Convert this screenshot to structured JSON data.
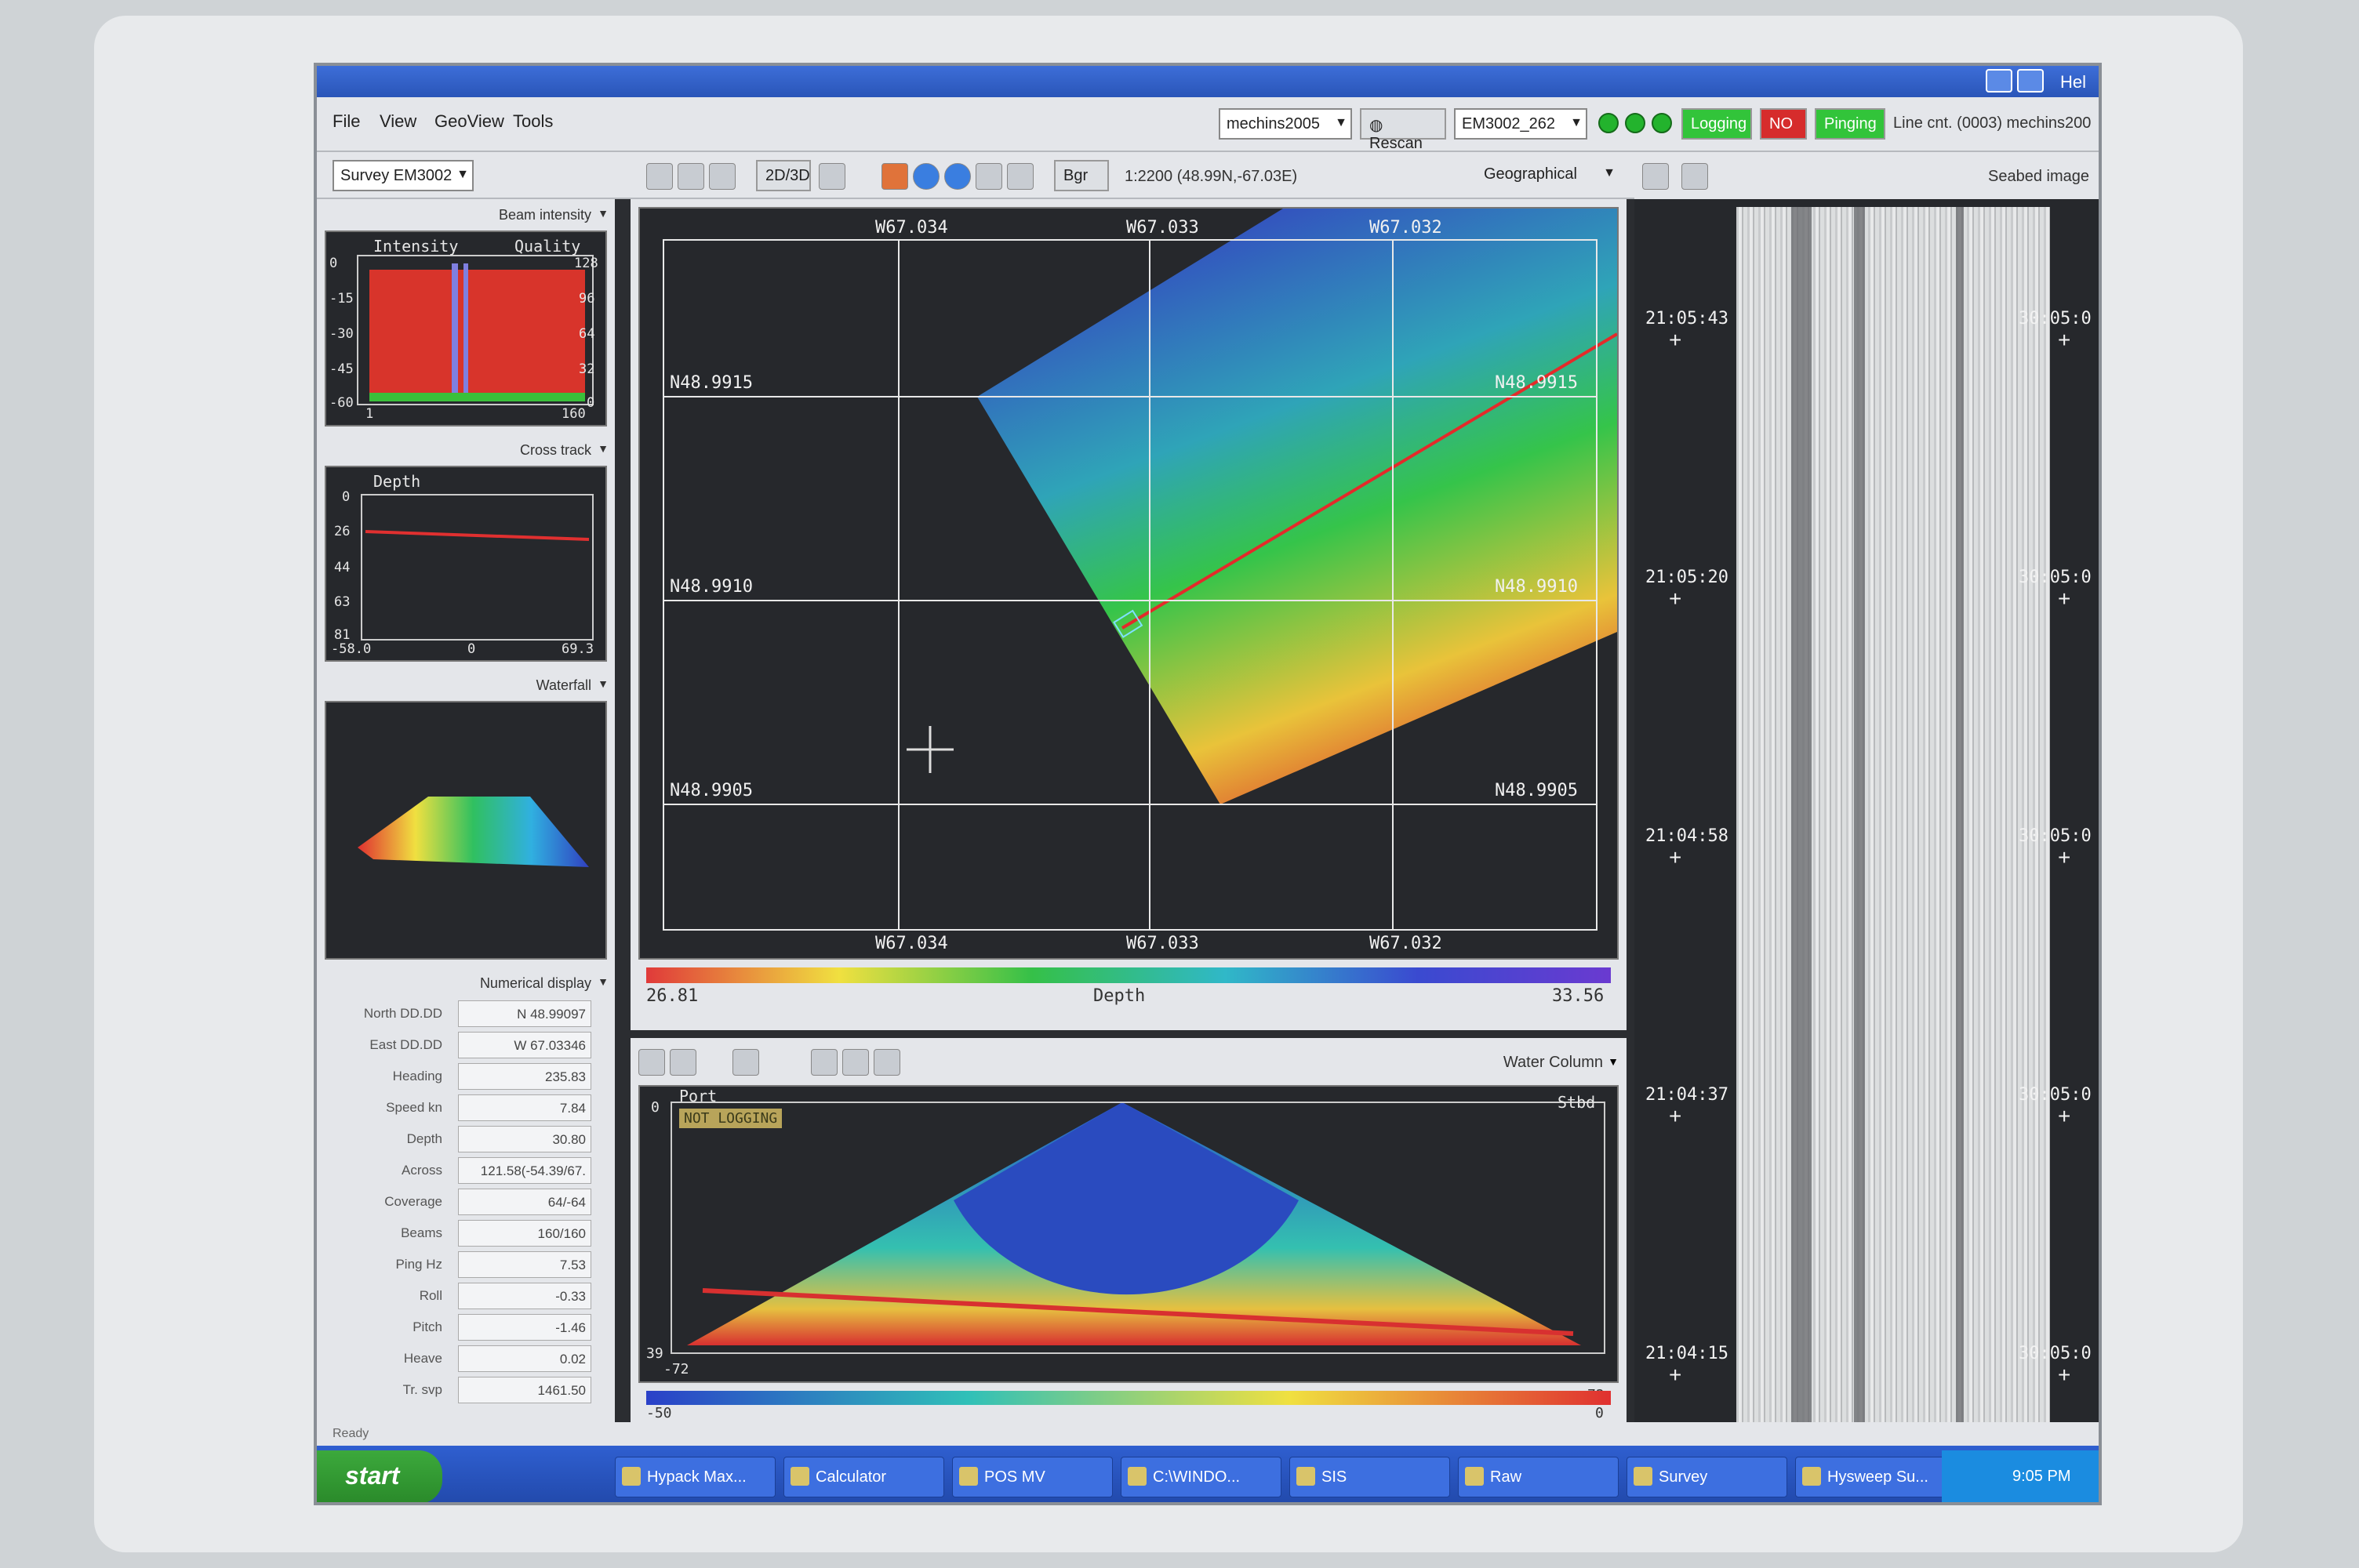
{
  "window": {
    "help_label": "Hel"
  },
  "menu": {
    "file": "File",
    "view": "View",
    "geoview": "GeoView",
    "tools": "Tools"
  },
  "header": {
    "project_combo": "mechins2005",
    "rescan_label": "Rescan",
    "sensor_combo": "EM3002_262",
    "logging": "Logging",
    "red_status": "NO",
    "pinging": "Pinging",
    "line_counter": "Line cnt. (0003) mechins200"
  },
  "toolbar": {
    "survey_combo": "Survey EM3002",
    "view_2d3d": "2D/3D",
    "bgr": "Bgr",
    "scale_readout": "1:2200 (48.99N,-67.03E)",
    "projection_combo": "Geographical",
    "seabed_label": "Seabed image"
  },
  "beam_panel": {
    "selector": "Beam intensity",
    "intensity_label": "Intensity",
    "quality_label": "Quality",
    "left_ticks": [
      "0",
      "-15",
      "-30",
      "-45",
      "-60"
    ],
    "right_ticks": [
      "128",
      "96",
      "64",
      "32",
      "0"
    ],
    "x_min": "1",
    "x_max": "160"
  },
  "cross_panel": {
    "selector": "Cross track",
    "depth_label": "Depth",
    "y_ticks": [
      "0",
      "26",
      "44",
      "63",
      "81"
    ],
    "x_ticks": [
      "-58.0",
      "0",
      "69.3"
    ]
  },
  "waterfall_panel": {
    "selector": "Waterfall"
  },
  "numerical": {
    "selector": "Numerical display",
    "rows": [
      {
        "label": "North DD.DD",
        "value": "N 48.99097"
      },
      {
        "label": "East DD.DD",
        "value": "W 67.03346"
      },
      {
        "label": "Heading",
        "value": "235.83"
      },
      {
        "label": "Speed kn",
        "value": "7.84"
      },
      {
        "label": "Depth",
        "value": "30.80"
      },
      {
        "label": "Across",
        "value": "121.58(-54.39/67."
      },
      {
        "label": "Coverage",
        "value": "64/-64"
      },
      {
        "label": "Beams",
        "value": "160/160"
      },
      {
        "label": "Ping Hz",
        "value": "7.53"
      },
      {
        "label": "Roll",
        "value": "-0.33"
      },
      {
        "label": "Pitch",
        "value": "-1.46"
      },
      {
        "label": "Heave",
        "value": "0.02"
      },
      {
        "label": "Tr. svp",
        "value": "1461.50"
      }
    ]
  },
  "map": {
    "top_lon": [
      "W67.034",
      "W67.033",
      "W67.032"
    ],
    "bottom_lon": [
      "W67.034",
      "W67.033",
      "W67.032"
    ],
    "left_lat": [
      "N48.9915",
      "N48.9910",
      "N48.9905"
    ],
    "right_lat": [
      "N48.9915",
      "N48.9910",
      "N48.9905"
    ],
    "colorbar_min": "26.81",
    "colorbar_label": "Depth",
    "colorbar_max": "33.56"
  },
  "water_column": {
    "selector": "Water Column",
    "port": "Port",
    "stbd": "Stbd",
    "not_logging": "NOT LOGGING",
    "y_top": "0",
    "y_bottom": "39",
    "x_min": "-72",
    "x_max": "72",
    "colorbar_min": "-50",
    "colorbar_max": "0"
  },
  "seabed": {
    "times": [
      "21:05:43",
      "21:05:20",
      "21:04:58",
      "21:04:37",
      "21:04:15"
    ],
    "right_times": [
      "30:05:0",
      "30:05:0",
      "30:05:0",
      "30:05:0",
      "30:05:0"
    ]
  },
  "status": {
    "text": "Ready"
  },
  "taskbar": {
    "start": "start",
    "tasks": [
      "Hypack Max...",
      "Calculator",
      "POS MV",
      "C:\\WINDO...",
      "SIS",
      "Raw",
      "Survey",
      "Hysweep Su..."
    ],
    "clock": "9:05 PM"
  }
}
